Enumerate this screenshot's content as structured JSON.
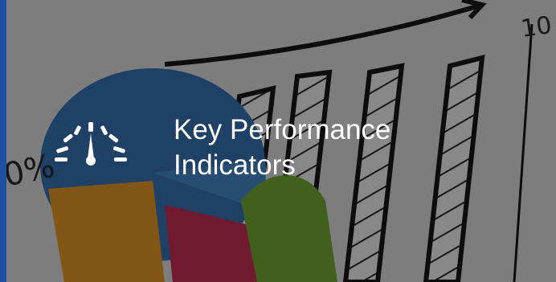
{
  "tile": {
    "title_line1": "Key Performance",
    "title_line2": "Indicators",
    "icon": "speedometer-icon",
    "accent_color": "#1f4e9c",
    "background_text": {
      "percent": "0%",
      "axis_top": "10"
    }
  }
}
